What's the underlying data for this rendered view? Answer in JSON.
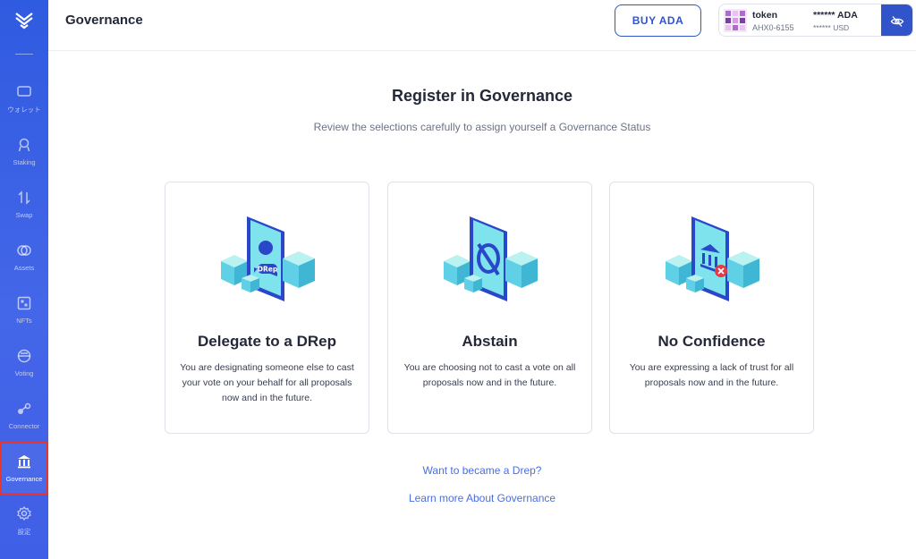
{
  "sidebar": {
    "items": [
      {
        "label": "ウォレット",
        "icon": "wallet-icon"
      },
      {
        "label": "Staking",
        "icon": "staking-icon"
      },
      {
        "label": "Swap",
        "icon": "swap-icon"
      },
      {
        "label": "Assets",
        "icon": "assets-icon"
      },
      {
        "label": "NFTs",
        "icon": "nft-icon"
      },
      {
        "label": "Voting",
        "icon": "voting-icon"
      },
      {
        "label": "Connector",
        "icon": "connector-icon"
      },
      {
        "label": "Governance",
        "icon": "governance-icon"
      },
      {
        "label": "設定",
        "icon": "settings-icon"
      }
    ],
    "active": "Governance"
  },
  "header": {
    "title": "Governance",
    "buy_label": "BUY ADA",
    "wallet": {
      "name": "token",
      "id": "AHX0-6155",
      "balance": "****** ADA",
      "usd": "****** USD"
    }
  },
  "main": {
    "title": "Register in Governance",
    "subtitle": "Review the selections carefully to assign yourself a Governance Status",
    "cards": [
      {
        "title": "Delegate to a DRep",
        "description": "You are designating someone else to cast your vote on your behalf for all proposals now and in the future.",
        "badge": "DRep"
      },
      {
        "title": "Abstain",
        "description": "You are choosing not to cast a vote on all proposals now and in the future."
      },
      {
        "title": "No Confidence",
        "description": "You are expressing a lack of trust for all proposals now and in the future."
      }
    ],
    "links": {
      "become_drep": "Want to became a Drep?",
      "learn_more": "Learn more About Governance"
    }
  },
  "colors": {
    "sidebar": "#3f5fe6",
    "accent": "#3154cb",
    "link": "#4a6ee0",
    "active_border": "#e5362f"
  }
}
